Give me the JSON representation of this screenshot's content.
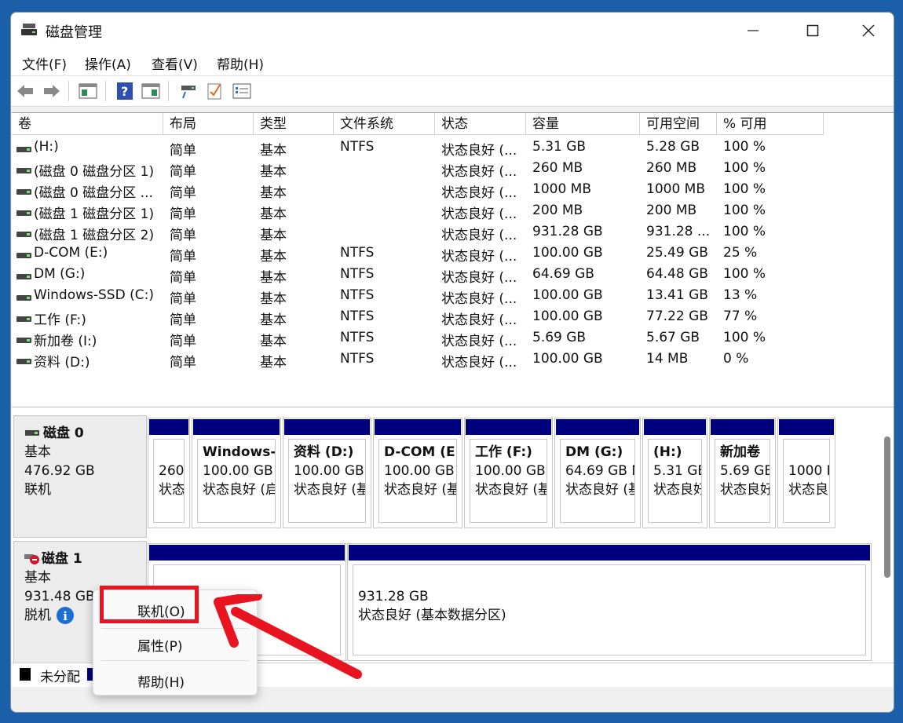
{
  "window": {
    "title": "磁盘管理",
    "minimize_glyph": "—",
    "maximize_glyph": "☐",
    "close_glyph": "✕"
  },
  "menu": [
    "文件(F)",
    "操作(A)",
    "查看(V)",
    "帮助(H)"
  ],
  "toolbar_icons": [
    "back-arrow-icon",
    "forward-arrow-icon",
    "console-icon",
    "help-icon",
    "panel-icon",
    "connect-icon",
    "check-icon",
    "list-icon"
  ],
  "table": {
    "columns": [
      "卷",
      "布局",
      "类型",
      "文件系统",
      "状态",
      "容量",
      "可用空间",
      "% 可用"
    ],
    "rows": [
      [
        "(H:)",
        "简单",
        "基本",
        "NTFS",
        "状态良好 (...",
        "5.31 GB",
        "5.28 GB",
        "100 %"
      ],
      [
        "(磁盘 0 磁盘分区 1)",
        "简单",
        "基本",
        "",
        "状态良好 (...",
        "260 MB",
        "260 MB",
        "100 %"
      ],
      [
        "(磁盘 0 磁盘分区 ...",
        "简单",
        "基本",
        "",
        "状态良好 (...",
        "1000 MB",
        "1000 MB",
        "100 %"
      ],
      [
        "(磁盘 1 磁盘分区 1)",
        "简单",
        "基本",
        "",
        "状态良好 (...",
        "200 MB",
        "200 MB",
        "100 %"
      ],
      [
        "(磁盘 1 磁盘分区 2)",
        "简单",
        "基本",
        "",
        "状态良好 (...",
        "931.28 GB",
        "931.28 ...",
        "100 %"
      ],
      [
        "D-COM (E:)",
        "简单",
        "基本",
        "NTFS",
        "状态良好 (...",
        "100.00 GB",
        "25.49 GB",
        "25 %"
      ],
      [
        "DM (G:)",
        "简单",
        "基本",
        "NTFS",
        "状态良好 (...",
        "64.69 GB",
        "64.48 GB",
        "100 %"
      ],
      [
        "Windows-SSD (C:)",
        "简单",
        "基本",
        "NTFS",
        "状态良好 (...",
        "100.00 GB",
        "13.41 GB",
        "13 %"
      ],
      [
        "工作 (F:)",
        "简单",
        "基本",
        "NTFS",
        "状态良好 (...",
        "100.00 GB",
        "77.22 GB",
        "77 %"
      ],
      [
        "新加卷 (I:)",
        "简单",
        "基本",
        "NTFS",
        "状态良好 (...",
        "5.69 GB",
        "5.67 GB",
        "100 %"
      ],
      [
        "资料 (D:)",
        "简单",
        "基本",
        "NTFS",
        "状态良好 (...",
        "100.00 GB",
        "14 MB",
        "0 %"
      ]
    ]
  },
  "disk0": {
    "name": "磁盘 0",
    "type": "基本",
    "size": "476.92 GB",
    "status": "联机",
    "partitions": [
      {
        "name": "",
        "size": "260",
        "status": "状态"
      },
      {
        "name": "Windows-",
        "size": "100.00 GB",
        "status": "状态良好 (启"
      },
      {
        "name": "资料  (D:)",
        "size": "100.00 GB",
        "status": "状态良好 (基"
      },
      {
        "name": "D-COM  (E",
        "size": "100.00 GB",
        "status": "状态良好 (基"
      },
      {
        "name": "工作  (F:)",
        "size": "100.00 GB",
        "status": "状态良好 (基"
      },
      {
        "name": "DM  (G:)",
        "size": "64.69 GB N",
        "status": "状态良好 (基"
      },
      {
        "name": "(H:)",
        "size": "5.31 GE",
        "status": "状态良好"
      },
      {
        "name": "新加卷",
        "size": "5.69 GE",
        "status": "状态良好"
      },
      {
        "name": "",
        "size": "1000 I",
        "status": "状态良"
      }
    ]
  },
  "disk1": {
    "name": "磁盘 1",
    "type": "基本",
    "size": "931.48 GB",
    "status": "脱机",
    "partitions": [
      {
        "name": "",
        "size": "",
        "status": "统分区)"
      },
      {
        "name": "",
        "size": "931.28 GB",
        "status": "状态良好 (基本数据分区)"
      }
    ]
  },
  "legend": {
    "unallocated": "未分配"
  },
  "context_menu": [
    "联机(O)",
    "属性(P)",
    "帮助(H)"
  ],
  "colors": {
    "partition_header": "#00007f",
    "highlight": "#e8141f",
    "background": "#1a5fa8"
  }
}
